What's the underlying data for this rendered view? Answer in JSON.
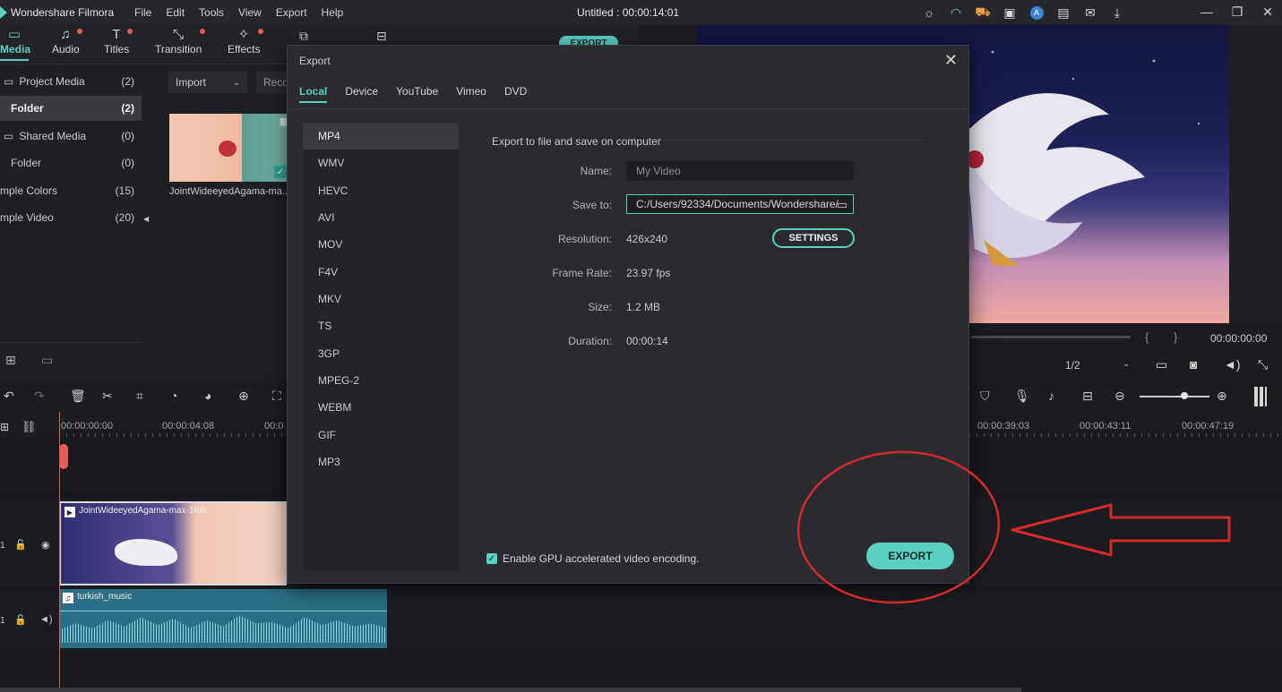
{
  "app": {
    "name": "Wondershare Filmora",
    "menu": [
      "File",
      "Edit",
      "Tools",
      "View",
      "Export",
      "Help"
    ],
    "doc_title": "Untitled : 00:00:14:01",
    "title_icons": [
      "bulb-icon",
      "headset-icon",
      "cart-icon",
      "gift-icon",
      "account-icon",
      "save-icon",
      "mail-icon",
      "download-icon"
    ]
  },
  "toolbar": {
    "tabs": [
      {
        "label": "Media",
        "icon": "folder-icon"
      },
      {
        "label": "Audio",
        "icon": "music-note-icon"
      },
      {
        "label": "Titles",
        "icon": "text-icon"
      },
      {
        "label": "Transition",
        "icon": "transition-icon"
      },
      {
        "label": "Effects",
        "icon": "effects-icon"
      }
    ],
    "export_partial": "EXPORT"
  },
  "left_panel": {
    "items": [
      {
        "label": "Project Media",
        "count": "(2)"
      },
      {
        "label": "Folder",
        "count": "(2)"
      },
      {
        "label": "Shared Media",
        "count": "(0)"
      },
      {
        "label": "Folder",
        "count": "(0)"
      },
      {
        "label": "mple Colors",
        "count": "(15)"
      },
      {
        "label": "mple Video",
        "count": "(20)"
      }
    ]
  },
  "media": {
    "import_label": "Import",
    "record_label": "Reco",
    "clip_name": "JointWideeyedAgama-ma..."
  },
  "preview": {
    "timecode": "00:00:00:00",
    "quality": "1/2"
  },
  "timeline": {
    "ticks": [
      "00:00:00:00",
      "00:00:04:08",
      "00:0",
      "00:00:39:03",
      "00:00:43:11",
      "00:00:47:19"
    ],
    "video_clip": "JointWideeyedAgama-max-1mb",
    "audio_clip": "turkish_music",
    "track_numbers": [
      "1",
      "1"
    ]
  },
  "dialog": {
    "title": "Export",
    "tabs": [
      "Local",
      "Device",
      "YouTube",
      "Vimeo",
      "DVD"
    ],
    "formats": [
      "MP4",
      "WMV",
      "HEVC",
      "AVI",
      "MOV",
      "F4V",
      "MKV",
      "TS",
      "3GP",
      "MPEG-2",
      "WEBM",
      "GIF",
      "MP3"
    ],
    "section_title": "Export to file and save on computer",
    "fields": {
      "name_label": "Name:",
      "name_placeholder": "My Video",
      "saveto_label": "Save to:",
      "saveto_value": "C:/Users/92334/Documents/Wondershare/",
      "resolution_label": "Resolution:",
      "resolution_value": "426x240",
      "framerate_label": "Frame Rate:",
      "framerate_value": "23.97 fps",
      "size_label": "Size:",
      "size_value": "1.2 MB",
      "duration_label": "Duration:",
      "duration_value": "00:00:14"
    },
    "settings_label": "SETTINGS",
    "gpu_label": "Enable GPU accelerated video encoding.",
    "export_label": "EXPORT"
  },
  "colors": {
    "accent": "#5ad0c2",
    "annotation": "#d62a2a"
  }
}
